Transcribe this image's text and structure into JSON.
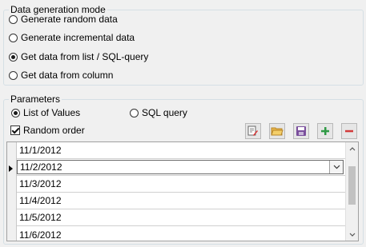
{
  "mode_group": {
    "legend": "Data generation mode",
    "options": [
      {
        "label": "Generate random data",
        "checked": false
      },
      {
        "label": "Generate incremental data",
        "checked": false
      },
      {
        "label": "Get data from list / SQL-query",
        "checked": true
      },
      {
        "label": "Get data from column",
        "checked": false
      }
    ]
  },
  "params_group": {
    "legend": "Parameters",
    "list_of_values_label": "List of Values",
    "list_of_values_checked": true,
    "sql_query_label": "SQL query",
    "sql_query_checked": false,
    "random_order_label": "Random order",
    "random_order_checked": true
  },
  "toolbar": {
    "icons": [
      "edit-list-icon",
      "open-folder-icon",
      "save-icon",
      "add-icon",
      "remove-icon"
    ],
    "colors": {
      "open": "#e8b64a",
      "save": "#7a4e9c",
      "add": "#2f9a45",
      "remove": "#d23a3a"
    }
  },
  "values_grid": {
    "rows": [
      "11/1/2012",
      "11/2/2012",
      "11/3/2012",
      "11/4/2012",
      "11/5/2012",
      "11/6/2012"
    ],
    "current_row": 1
  }
}
